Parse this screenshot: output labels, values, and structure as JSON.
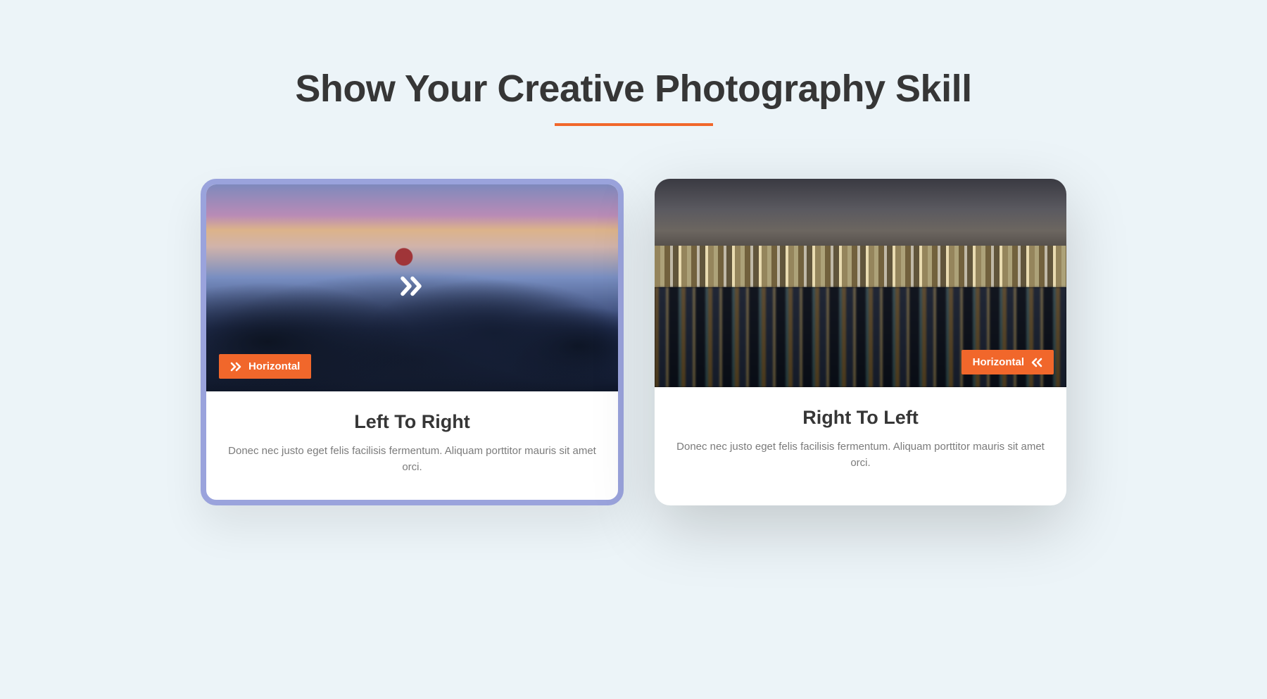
{
  "section": {
    "title": "Show Your Creative Photography Skill"
  },
  "cards": [
    {
      "badge_label": "Horizontal",
      "title": "Left To Right",
      "desc": "Donec nec justo eget felis facilisis fermentum. Aliquam porttitor mauris sit amet orci."
    },
    {
      "badge_label": "Horizontal",
      "title": "Right To Left",
      "desc": "Donec nec justo eget felis facilisis fermentum. Aliquam porttitor mauris sit amet orci."
    }
  ]
}
